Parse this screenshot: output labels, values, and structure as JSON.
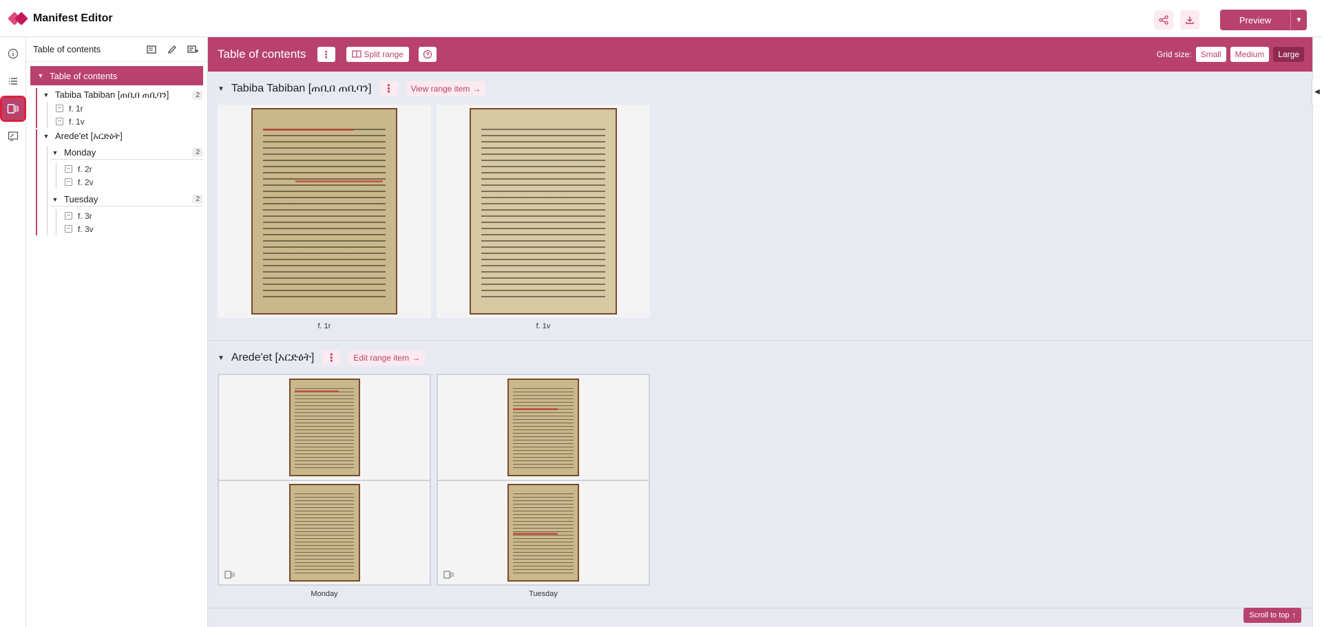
{
  "app": {
    "title": "Manifest Editor",
    "preview_label": "Preview"
  },
  "rail": {
    "icons": [
      "info-icon",
      "list-icon",
      "ranges-icon",
      "annotations-icon"
    ]
  },
  "sidebar": {
    "title": "Table of contents",
    "root": "Table of contents",
    "ranges": [
      {
        "label": "Tabiba Tabiban [ጠቢበ ጠቢባን]",
        "count": "2",
        "items": [
          "f. 1r",
          "f. 1v"
        ]
      },
      {
        "label": "Arede'et [አርድዕት]",
        "children": [
          {
            "label": "Monday",
            "count": "2",
            "items": [
              "f. 2r",
              "f. 2v"
            ]
          },
          {
            "label": "Tuesday",
            "count": "2",
            "items": [
              "f. 3r",
              "f. 3v"
            ]
          }
        ]
      }
    ]
  },
  "main": {
    "title": "Table of contents",
    "split_range": "Split range",
    "grid_size_label": "Grid size:",
    "grid_sizes": [
      "Small",
      "Medium",
      "Large"
    ],
    "grid_size_selected": "Large",
    "sections": [
      {
        "title": "Tabiba Tabiban [ጠቢበ ጠቢባን]",
        "link": "View range item",
        "cards": [
          "f. 1r",
          "f. 1v"
        ]
      },
      {
        "title": "Arede'et [አርድዕት]",
        "link": "Edit range item",
        "cards": [
          "Monday",
          "Tuesday"
        ]
      }
    ],
    "scroll_top": "Scroll to top"
  },
  "colors": {
    "accent": "#b8426d",
    "accent_dark": "#8e2a52",
    "highlight": "#e01e37",
    "canvas_bg": "#e8eaf2"
  }
}
